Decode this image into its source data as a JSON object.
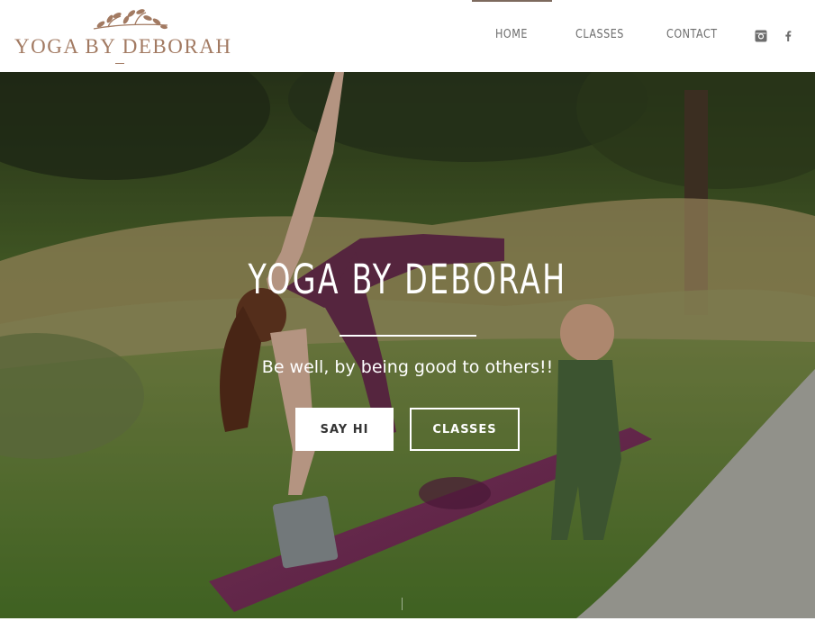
{
  "header": {
    "logo_text": "YOGA BY DEBORAH"
  },
  "nav": {
    "items": [
      {
        "label": "HOME",
        "active": true
      },
      {
        "label": "CLASSES",
        "active": false
      },
      {
        "label": "CONTACT",
        "active": false
      }
    ],
    "social": [
      "instagram-icon",
      "facebook-icon"
    ]
  },
  "hero": {
    "title": "YOGA BY DEBORAH",
    "tagline": "Be well, by being good to others!!",
    "buttons": {
      "primary": "SAY HI",
      "secondary": "CLASSES"
    }
  },
  "colors": {
    "brand": "#a27a62",
    "nav_text": "#6d6d6d",
    "mat": "#7a2f5c"
  }
}
